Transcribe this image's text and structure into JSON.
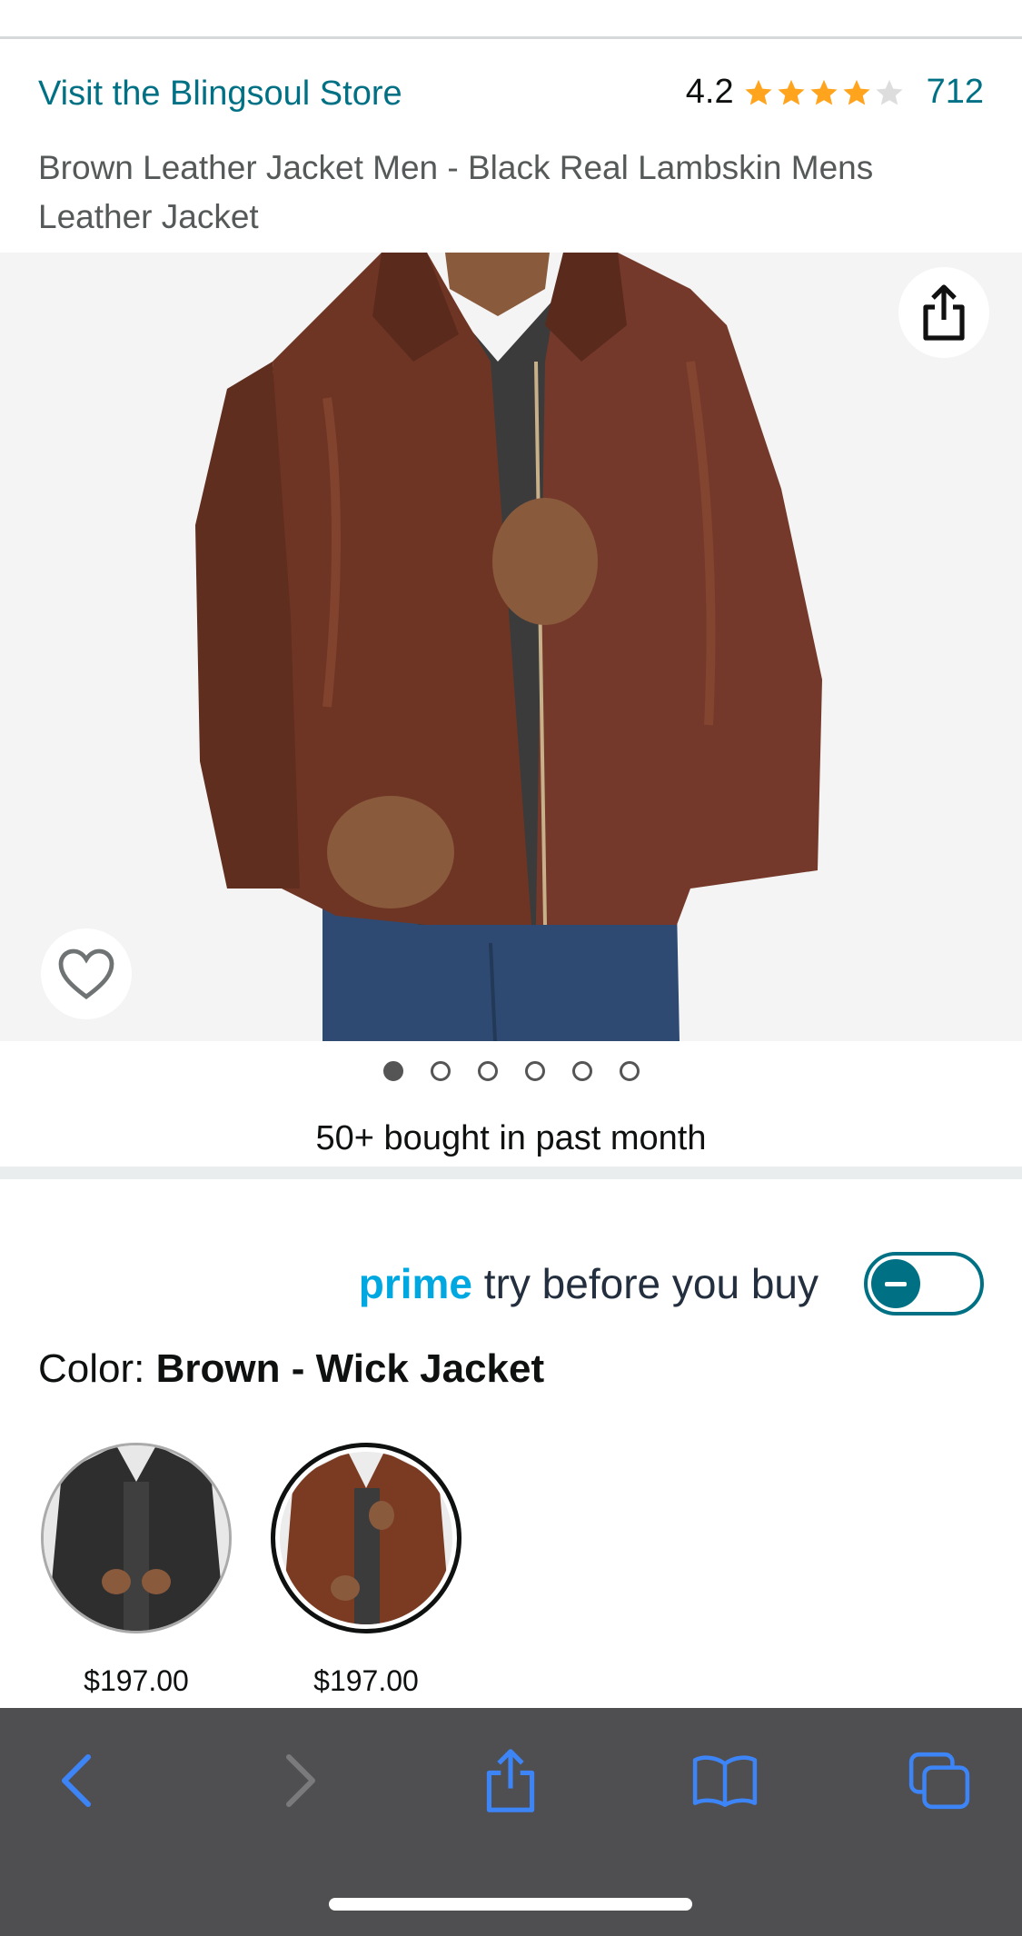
{
  "header": {
    "store_link": "Visit the Blingsoul Store",
    "rating_value": "4.2",
    "stars_filled": 4.2,
    "stars_total": 5,
    "ratings_count": "712",
    "title": "Brown Leather Jacket Men - Black Real Lambskin Mens Leather Jacket"
  },
  "gallery": {
    "image_count": 6,
    "active_index": 0,
    "share_icon": "share-icon",
    "wishlist_icon": "heart-icon",
    "bought_text": "50+ bought in past month"
  },
  "prime": {
    "prime_word": "prime",
    "rest_text": "try before you buy",
    "toggle_state": "off"
  },
  "color": {
    "label": "Color:",
    "selected": "Brown - Wick Jacket",
    "options": [
      {
        "price": "$197.00",
        "swatch": "#2e2e2e"
      },
      {
        "price": "$197.00",
        "swatch": "#7a3b22"
      }
    ]
  },
  "toolbar": {
    "icons": [
      "back-icon",
      "forward-icon",
      "share-icon",
      "bookmarks-icon",
      "tabs-icon"
    ],
    "accent": "#3d84f7"
  }
}
